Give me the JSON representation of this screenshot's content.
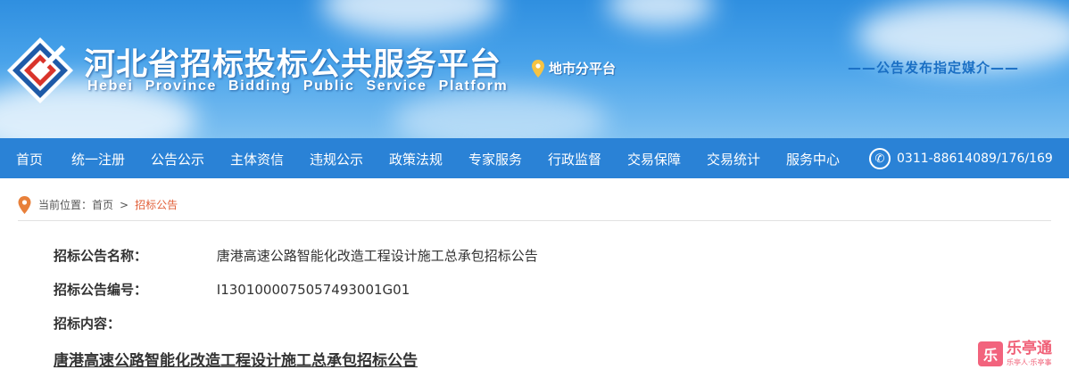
{
  "header": {
    "title": "河北省招标投标公共服务平台",
    "subtitle": "Hebei Province Bidding Public Service Platform",
    "city_link": "地市分平台",
    "slogan": "——公告发布指定媒介——",
    "logo_icon": "diamond-logo-icon"
  },
  "nav": {
    "items": [
      "首页",
      "统一注册",
      "公告公示",
      "主体资信",
      "违规公示",
      "政策法规",
      "专家服务",
      "行政监督",
      "交易保障",
      "交易统计",
      "服务中心"
    ],
    "phone": "0311-88614089/176/169",
    "phone_icon": "phone-icon"
  },
  "breadcrumb": {
    "prefix": "当前位置：",
    "home": "首页",
    "separator": ">",
    "current": "招标公告"
  },
  "detail": {
    "name_label": "招标公告名称：",
    "name_value": "唐港高速公路智能化改造工程设计施工总承包招标公告",
    "code_label": "招标公告编号：",
    "code_value": "I1301000075057493001G01",
    "content_label": "招标内容：",
    "notice_title": "唐港高速公路智能化改造工程设计施工总承包招标公告"
  },
  "watermark": {
    "badge": "乐",
    "main": "乐亭通",
    "sub": "乐亭人·乐亭事"
  },
  "colors": {
    "nav_bg": "#2a82d6",
    "banner_top": "#2f8fe0",
    "accent": "#e2603a",
    "slogan": "#1a6fc4"
  }
}
